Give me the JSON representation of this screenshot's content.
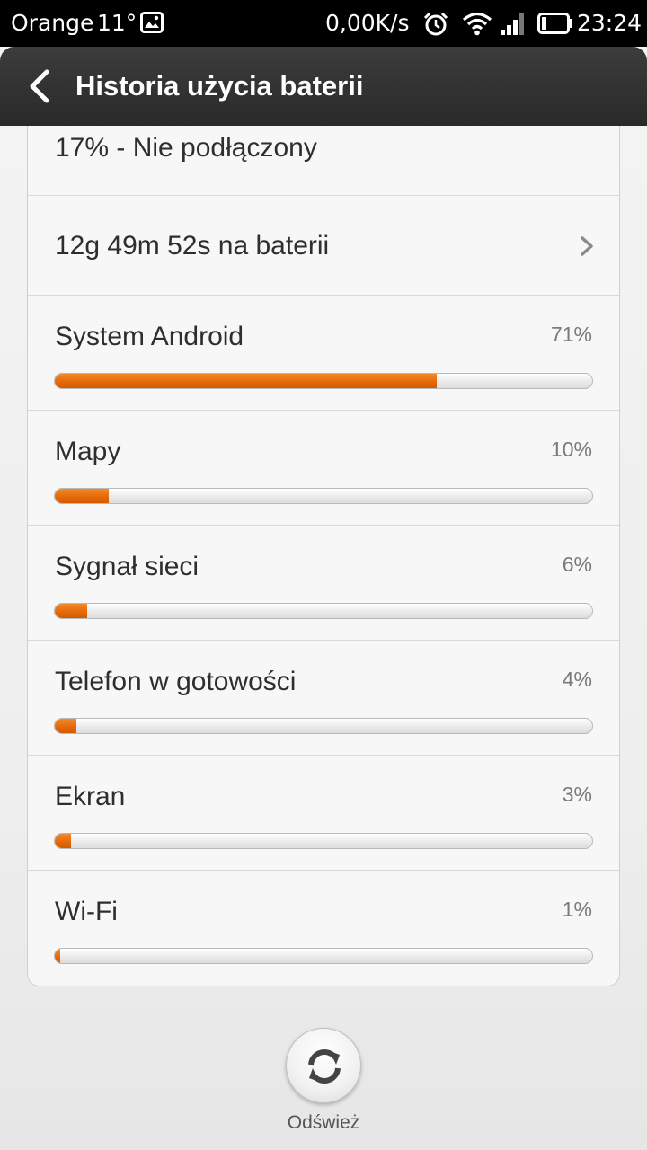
{
  "status_bar": {
    "carrier": "Orange",
    "temperature": "11°",
    "net_speed": "0,00K/s",
    "time": "23:24",
    "icons": [
      "image-icon",
      "alarm-icon",
      "wifi-icon",
      "signal-icon",
      "battery-icon"
    ]
  },
  "header": {
    "title": "Historia użycia baterii",
    "back_icon": "chevron-left-icon"
  },
  "battery": {
    "status": "17% - Nie podłączony",
    "duration": "12g 49m 52s na baterii"
  },
  "usage": [
    {
      "name": "System Android",
      "percent_label": "71%",
      "fraction": 0.71
    },
    {
      "name": "Mapy",
      "percent_label": "10%",
      "fraction": 0.1
    },
    {
      "name": "Sygnał sieci",
      "percent_label": "6%",
      "fraction": 0.06
    },
    {
      "name": "Telefon w gotowości",
      "percent_label": "4%",
      "fraction": 0.04
    },
    {
      "name": "Ekran",
      "percent_label": "3%",
      "fraction": 0.03
    },
    {
      "name": "Wi-Fi",
      "percent_label": "1%",
      "fraction": 0.01
    }
  ],
  "refresh": {
    "label": "Odśwież",
    "icon": "refresh-icon"
  },
  "colors": {
    "accent": "#e66a0a",
    "header_bg": "#2f2f2f",
    "status_bar_bg": "#000000"
  }
}
